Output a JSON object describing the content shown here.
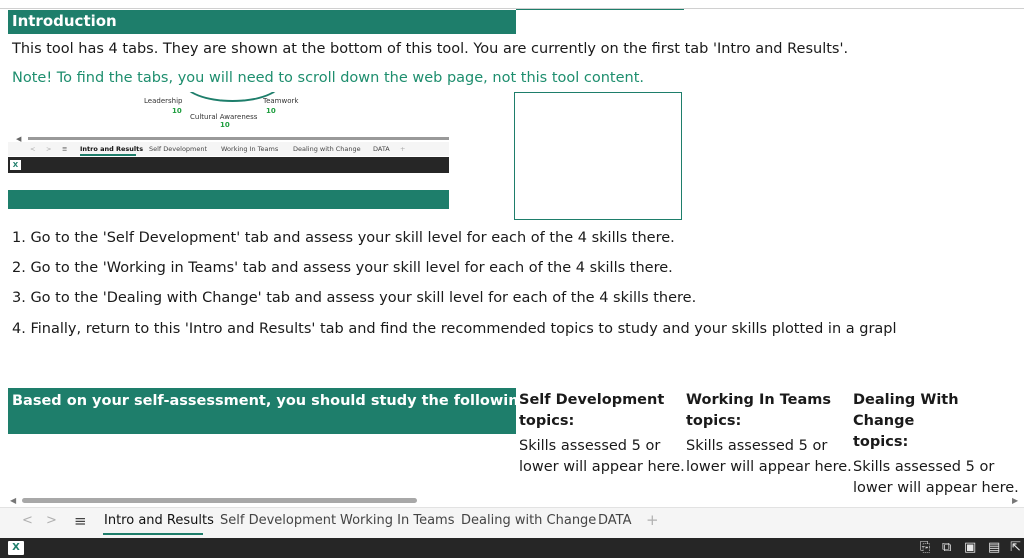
{
  "intro": {
    "title": "Introduction",
    "line1": "This tool has 4 tabs. They are shown at the bottom of this tool. You are currently on the first tab 'Intro and Results'.",
    "note": "Note! To find the tabs, you will need to scroll down the web page, not this tool content."
  },
  "preview": {
    "labels": {
      "leadership": "Leadership",
      "teamwork": "Teamwork",
      "cultural": "Cultural Awareness"
    },
    "values": {
      "leadership": "10",
      "teamwork": "10",
      "cultural": "10"
    },
    "tabs": [
      "Intro and Results",
      "Self Development",
      "Working In Teams",
      "Dealing with Change",
      "DATA"
    ],
    "nav_prev": "<",
    "nav_next": ">",
    "menu": "≡",
    "add": "+",
    "xl_letter": "X"
  },
  "steps": [
    "1. Go to the 'Self Development' tab and assess your skill level for each of the 4 skills there.",
    "2. Go to the 'Working in Teams' tab and assess your skill level for each of the 4 skills there.",
    "3. Go to the 'Dealing with Change' tab and assess your skill level for each of the 4 skills there.",
    "4. Finally, return to this 'Intro and Results' tab and find the recommended topics to study and your skills plotted in a grapl"
  ],
  "results": {
    "title": "Based on your self-assessment, you should study the following topics:",
    "columns": [
      {
        "head1": "Self Development",
        "head2": "topics:",
        "body1": "Skills assessed 5 or",
        "body2": "lower will appear here."
      },
      {
        "head1": "Working In Teams",
        "head2": "topics:",
        "body1": "Skills assessed 5 or",
        "body2": "lower will appear here."
      },
      {
        "head1": "Dealing With Change",
        "head2": "topics:",
        "body1": "Skills assessed 5 or",
        "body2": "lower will appear here."
      }
    ]
  },
  "scroll": {
    "left_arrow": "◀",
    "right_arrow": "▶"
  },
  "tabbar": {
    "prev": "<",
    "next": ">",
    "menu": "≡",
    "tabs": [
      "Intro and Results",
      "Self Development",
      "Working In Teams",
      "Dealing with Change",
      "DATA"
    ],
    "active_index": 0,
    "add": "+"
  },
  "statusbar": {
    "app_letter": "X",
    "icons": [
      "page-refresh-icon",
      "copy-icon",
      "save-icon",
      "reading-view-icon",
      "popout-icon"
    ],
    "glyphs": [
      "⎘",
      "⧉",
      "▣",
      "▤",
      "⇱"
    ]
  },
  "colors": {
    "accent": "#1e7e6b",
    "note": "#1e8e6e",
    "statusbar": "#262626"
  }
}
